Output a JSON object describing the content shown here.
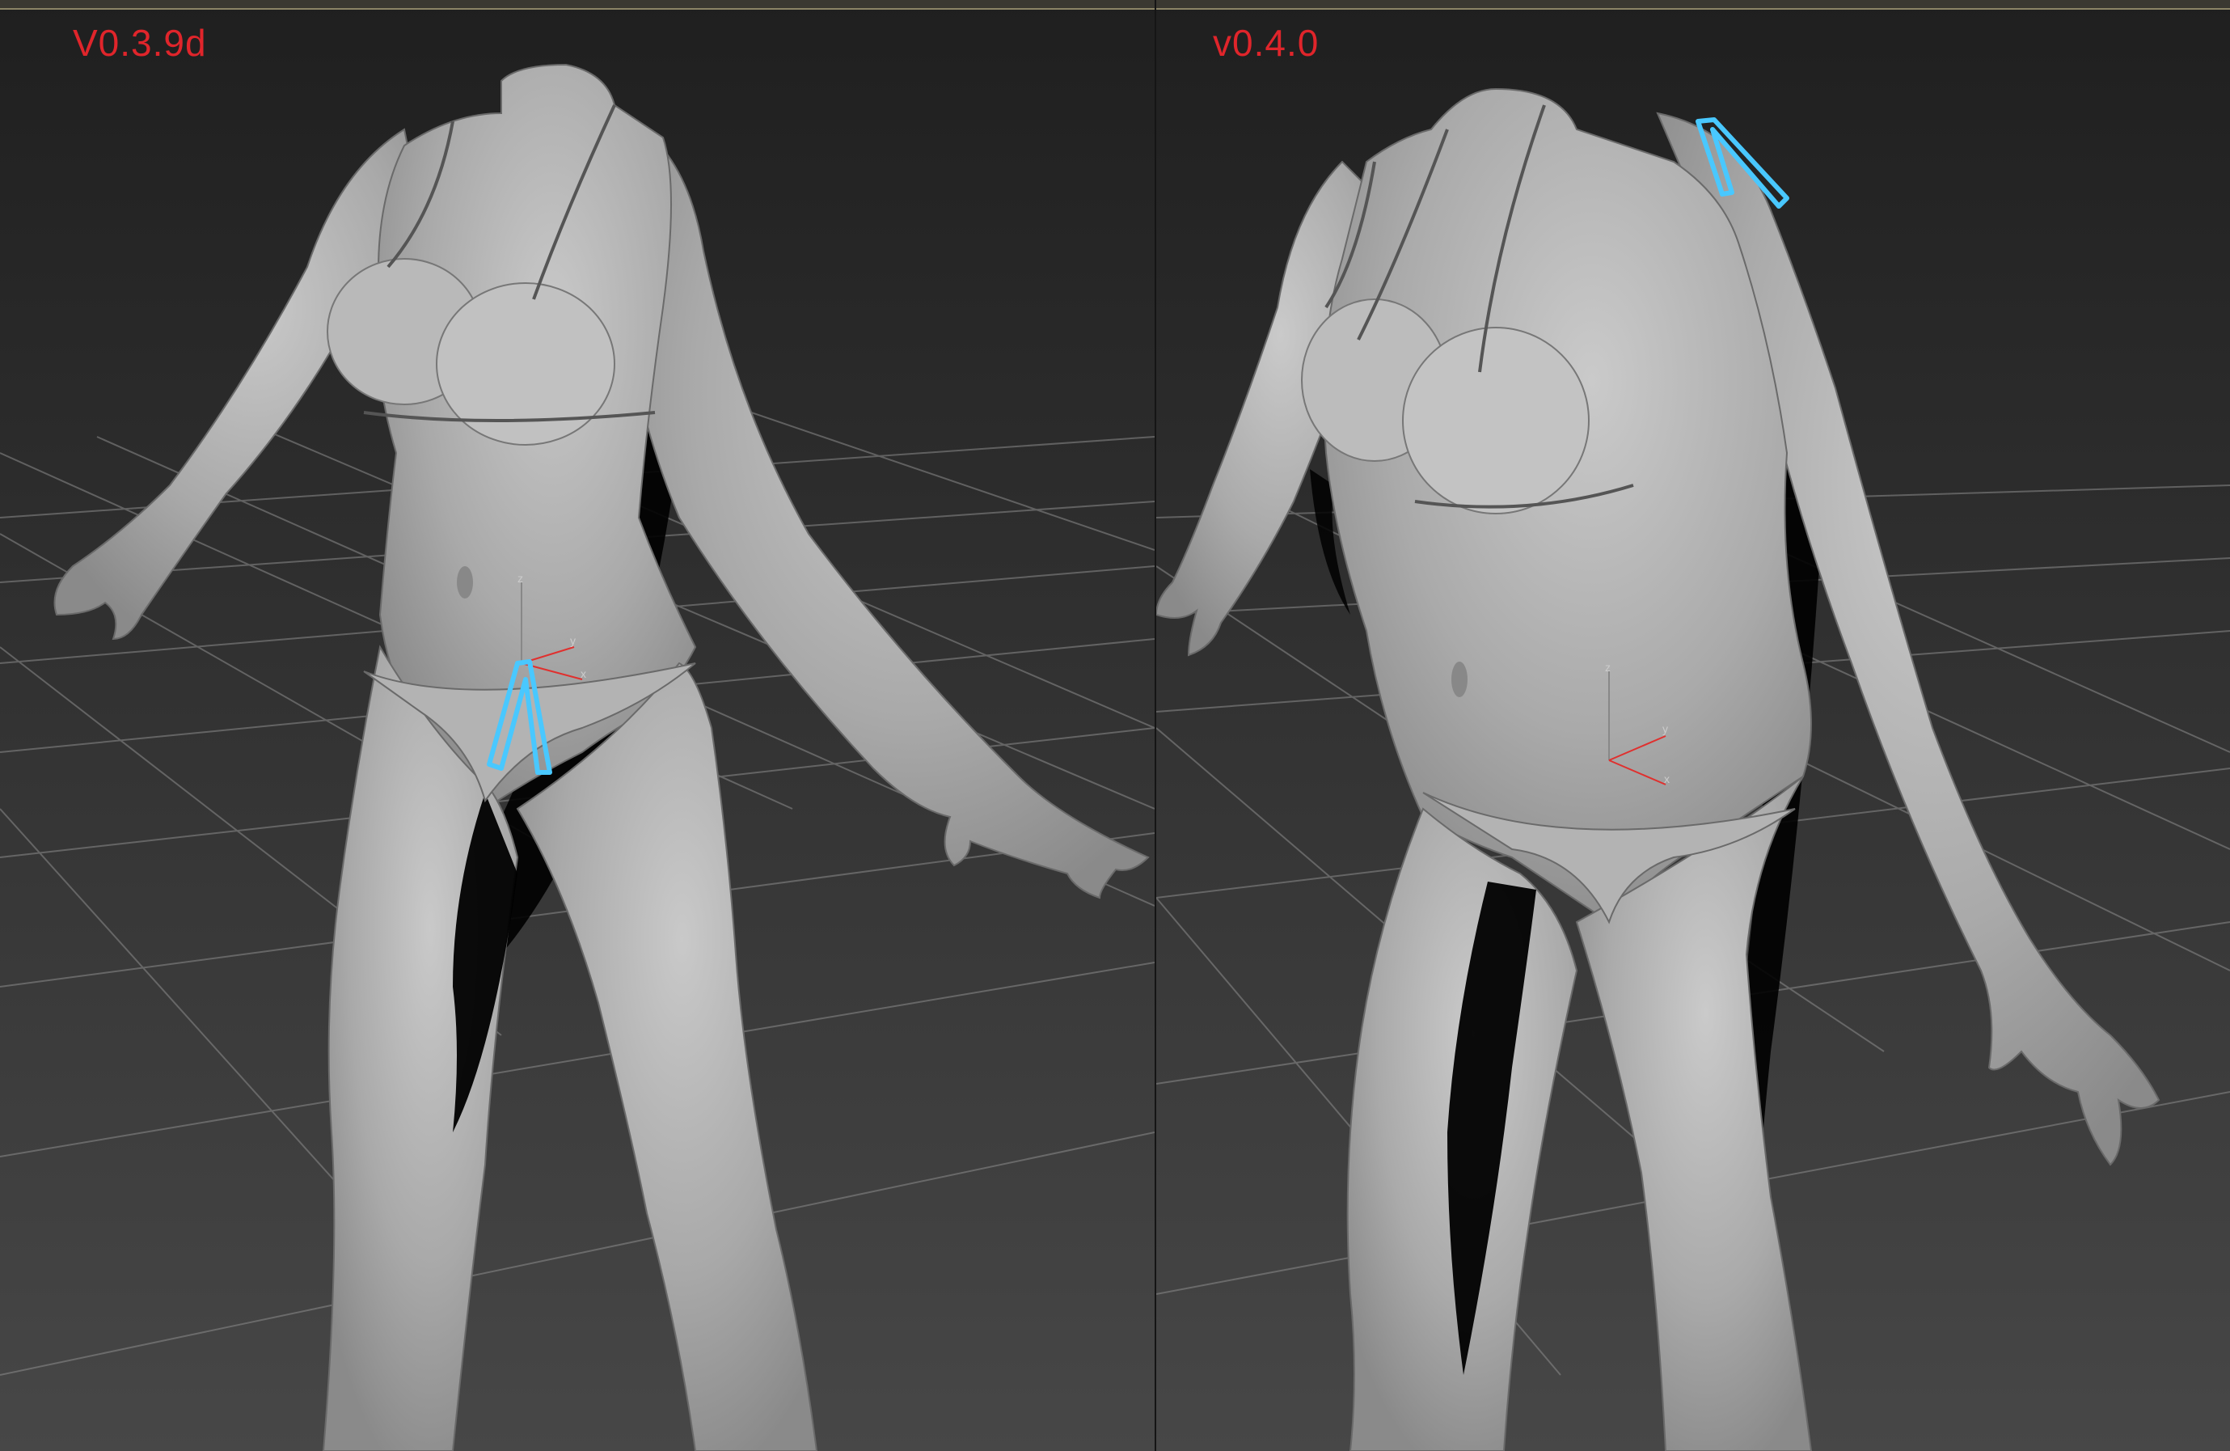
{
  "colors": {
    "label": "#e0252b",
    "background_top": "#1f1f1f",
    "background_bottom": "#454545",
    "grid": "#8c8c8c",
    "body": "#a6a6a6",
    "body_light": "#c4c4c4",
    "body_shadow": "#000000",
    "gizmo_highlight": "#49c8ff",
    "axis": "#e0302e",
    "viewport_frame": "#8b8466"
  },
  "viewports": [
    {
      "label": "V0.3.9d",
      "gizmo_axes": [
        "z",
        "y",
        "x"
      ],
      "selected_helper": "highlighted-bone-at-hip"
    },
    {
      "label": "v0.4.0",
      "gizmo_axes": [
        "z",
        "y",
        "x"
      ],
      "selected_helper": "highlighted-bone-at-shoulder"
    }
  ]
}
